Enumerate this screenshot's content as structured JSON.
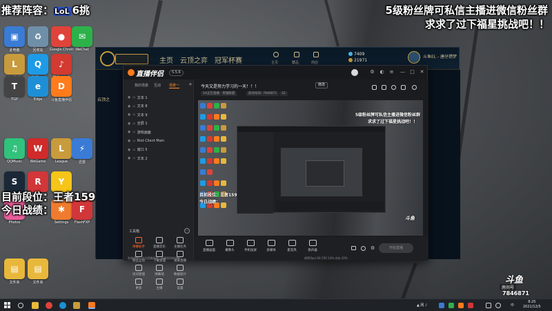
{
  "overlay": {
    "recommend_line": "推荐阵容：",
    "recommend_badge": "6挑",
    "fan_msg_line1": "5级粉丝牌可私信主播进微信粉丝群",
    "fan_msg_line2": "求求了过下福星挑战吧！！",
    "rank_line": "目前段位：王者1590",
    "today_line": "今日战绩："
  },
  "desktop_icons": [
    {
      "label": "此电脑",
      "color": "#3a7bd5",
      "glyph": "▣"
    },
    {
      "label": "回收站",
      "color": "#6f8fa8",
      "glyph": "♻"
    },
    {
      "label": "Google Chrome",
      "color": "#e0433a",
      "glyph": "●"
    },
    {
      "label": "WeChat",
      "color": "#2db14a",
      "glyph": "✉"
    },
    {
      "label": "英雄联盟",
      "color": "#c89b3c",
      "glyph": "L"
    },
    {
      "label": "腾讯QQ",
      "color": "#1e9be6",
      "glyph": "Q"
    },
    {
      "label": "网易云音乐",
      "color": "#d33a31",
      "glyph": "♪"
    },
    {
      "label": "TGP",
      "color": "#444",
      "glyph": "T"
    },
    {
      "label": "Edge",
      "color": "#1e8fd6",
      "glyph": "e"
    },
    {
      "label": "斗鱼直播伴侣",
      "color": "#ff7b1c",
      "glyph": "D"
    },
    {
      "label": "QQMusic",
      "color": "#31c27c",
      "glyph": "♫"
    },
    {
      "label": "WeGame",
      "color": "#d02a2a",
      "glyph": "W"
    },
    {
      "label": "League",
      "color": "#c89b3c",
      "glyph": "L"
    },
    {
      "label": "迅雷",
      "color": "#3a7bd5",
      "glyph": "⚡"
    },
    {
      "label": "Steam",
      "color": "#1b2838",
      "glyph": "S"
    },
    {
      "label": "Riot Client",
      "color": "#d13639",
      "glyph": "R"
    },
    {
      "label": "YY",
      "color": "#f5c518",
      "glyph": "Y"
    },
    {
      "label": "Photos",
      "color": "#e85d9a",
      "glyph": "✿"
    },
    {
      "label": "Settings",
      "color": "#f07b2e",
      "glyph": "✱"
    },
    {
      "label": "FlashFXP",
      "color": "#d13639",
      "glyph": "F"
    },
    {
      "label": "文件夹",
      "color": "#e8b83c",
      "glyph": "▤"
    },
    {
      "label": "文件夹",
      "color": "#e8b83c",
      "glyph": "▤"
    }
  ],
  "lol": {
    "nav": [
      "主页",
      "云顶之弈",
      "冠军杯赛"
    ],
    "side_label": "云顶之",
    "icons": [
      "主页",
      "藏品",
      "商店"
    ],
    "blue_essence": "7409",
    "riot_points": "21971",
    "player_name": "斗鱼EL - 唐仔攒梦"
  },
  "douyu": {
    "logo": "直播伴侣",
    "version": "5.5.6",
    "tabs": [
      "我的场景",
      "互动",
      "场景一"
    ],
    "scenes": [
      "文本 1",
      "文本 8",
      "文本 9",
      "全屏 1",
      "游戏画面",
      "Riot Client Main",
      "窗口 5",
      "文本 2"
    ],
    "room_title": "今天又是努力学习的一天！！！",
    "edit_label": "修改",
    "chips": [
      "SA正在直播 · 英雄联盟",
      "房间号ID: 7846871",
      "32"
    ],
    "tools_title": "工具箱",
    "tools": [
      {
        "label": "弹幕助手",
        "hot": true
      },
      {
        "label": "直播音乐",
        "hot": false
      },
      {
        "label": "主播任务",
        "hot": false
      },
      {
        "label": "粉丝互动",
        "hot": false
      },
      {
        "label": "下载管理",
        "hot": false
      },
      {
        "label": "录屏直播",
        "hot": false
      },
      {
        "label": "房间管理",
        "hot": false
      },
      {
        "label": "弹幕墙",
        "hot": false
      },
      {
        "label": "数据统计",
        "hot": false
      },
      {
        "label": "更多",
        "hot": false
      },
      {
        "label": "主播",
        "hot": false
      },
      {
        "label": "设置",
        "hot": false
      }
    ],
    "bottom": [
      "直播画面",
      "摄像头",
      "手机投屏",
      "多媒体",
      "麦克风",
      "扬声器"
    ],
    "start_live": "开始直播",
    "status": "帧率(fps) 60   CPU 14%   内存 43%",
    "notice": "系统通知：优化直播质量，请确保网络通畅",
    "preview_overlay_1": "5级粉丝牌可私信主播进微信粉丝群",
    "preview_overlay_2": "求求了过下福星挑战吧！！",
    "preview_rank": "目前段位：王者1590",
    "preview_today": "今日战绩："
  },
  "douyu_badge": {
    "mark": "斗鱼",
    "room_label": "房间号",
    "room_number": "7846871"
  },
  "taskbar": {
    "time": "8:25",
    "date": "2021/12/5",
    "ime": "中",
    "tray": "▲ 网 ♪"
  }
}
